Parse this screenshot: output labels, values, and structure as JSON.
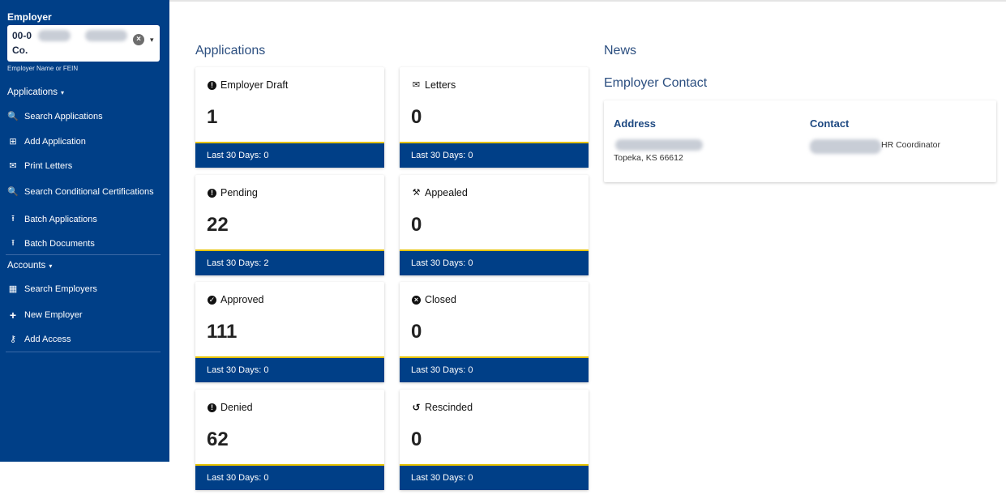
{
  "sidebar": {
    "employer_heading": "Employer",
    "employer_value_line1": "00-0",
    "employer_value_line2": "Co.",
    "clear_symbol": "×",
    "dropdown_caret": "▾",
    "employer_hint": "Employer Name or FEIN",
    "applications_section": "Applications",
    "accounts_section": "Accounts",
    "section_caret": "▾",
    "app_items": [
      {
        "label": "Search Applications",
        "icon": "search-file-icon",
        "glyph": "🔍"
      },
      {
        "label": "Add Application",
        "icon": "add-file-icon",
        "glyph": "⊞"
      },
      {
        "label": "Print Letters",
        "icon": "envelope-icon",
        "glyph": "✉"
      },
      {
        "label": "Search Conditional Certifications",
        "icon": "search-file-icon",
        "glyph": "🔍"
      },
      {
        "label": "Batch Applications",
        "icon": "upload-icon",
        "glyph": "⭱"
      },
      {
        "label": "Batch Documents",
        "icon": "upload-icon",
        "glyph": "⭱"
      }
    ],
    "account_items": [
      {
        "label": "Search Employers",
        "icon": "building-icon",
        "glyph": "▦"
      },
      {
        "label": "New Employer",
        "icon": "plus-icon",
        "glyph": "+"
      },
      {
        "label": "Add Access",
        "icon": "key-icon",
        "glyph": "⚷"
      }
    ]
  },
  "main": {
    "applications_title": "Applications",
    "news_title": "News",
    "employer_contact_title": "Employer Contact",
    "cards": [
      {
        "title": "Employer Draft",
        "value": "1",
        "footer": "Last 30 Days: 0",
        "icon": "exclamation-circle-icon",
        "glyph": "!"
      },
      {
        "title": "Letters",
        "value": "0",
        "footer": "Last 30 Days: 0",
        "icon": "envelope-icon",
        "glyph": "✉"
      },
      {
        "title": "Pending",
        "value": "22",
        "footer": "Last 30 Days: 2",
        "icon": "exclamation-circle-icon",
        "glyph": "!"
      },
      {
        "title": "Appealed",
        "value": "0",
        "footer": "Last 30 Days: 0",
        "icon": "gavel-icon",
        "glyph": "⚒"
      },
      {
        "title": "Approved",
        "value": "111",
        "footer": "Last 30 Days: 0",
        "icon": "check-circle-icon",
        "glyph": "✓"
      },
      {
        "title": "Closed",
        "value": "0",
        "footer": "Last 30 Days: 0",
        "icon": "times-circle-icon",
        "glyph": "×"
      },
      {
        "title": "Denied",
        "value": "62",
        "footer": "Last 30 Days: 0",
        "icon": "exclamation-circle-icon",
        "glyph": "!"
      },
      {
        "title": "Rescinded",
        "value": "0",
        "footer": "Last 30 Days: 0",
        "icon": "undo-icon",
        "glyph": "↺"
      }
    ],
    "contact": {
      "address_label": "Address",
      "address_city": "Topeka, KS 66612",
      "contact_label": "Contact",
      "contact_role": "HR Coordinator"
    }
  },
  "colors": {
    "sidebar_bg": "#003f87",
    "card_footer_bg": "#003f87",
    "footer_accent": "#e6c200",
    "heading_blue": "#2c4f80"
  }
}
